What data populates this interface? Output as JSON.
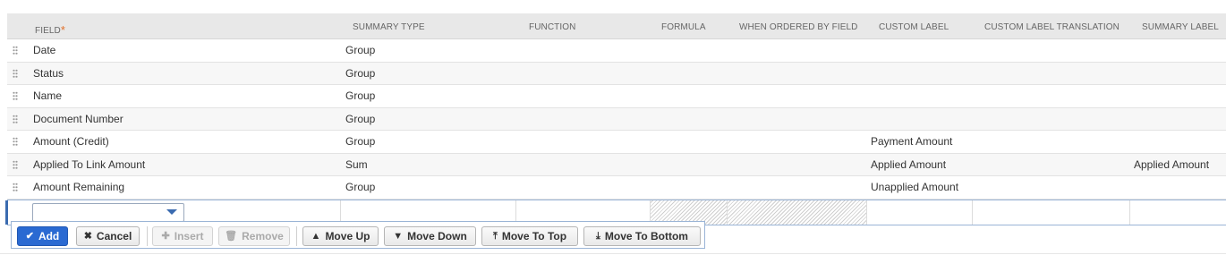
{
  "columns": {
    "field": "FIELD",
    "summary_type": "SUMMARY TYPE",
    "function": "FUNCTION",
    "formula": "FORMULA",
    "when_ordered": "WHEN ORDERED BY FIELD",
    "custom_label": "CUSTOM LABEL",
    "custom_label_translation": "CUSTOM LABEL TRANSLATION",
    "summary_label": "SUMMARY LABEL",
    "required_mark": "*"
  },
  "rows": [
    {
      "field": "Date",
      "summary_type": "Group",
      "custom_label": "",
      "summary_label": ""
    },
    {
      "field": "Status",
      "summary_type": "Group",
      "custom_label": "",
      "summary_label": ""
    },
    {
      "field": "Name",
      "summary_type": "Group",
      "custom_label": "",
      "summary_label": ""
    },
    {
      "field": "Document Number",
      "summary_type": "Group",
      "custom_label": "",
      "summary_label": ""
    },
    {
      "field": "Amount (Credit)",
      "summary_type": "Group",
      "custom_label": "Payment Amount",
      "summary_label": ""
    },
    {
      "field": "Applied To Link Amount",
      "summary_type": "Sum",
      "custom_label": "Applied Amount",
      "summary_label": "Applied Amount"
    },
    {
      "field": "Amount Remaining",
      "summary_type": "Group",
      "custom_label": "Unapplied Amount",
      "summary_label": ""
    }
  ],
  "editor": {
    "field_value": ""
  },
  "toolbar": {
    "add": "Add",
    "cancel": "Cancel",
    "insert": "Insert",
    "remove": "Remove",
    "move_up": "Move Up",
    "move_down": "Move Down",
    "move_to_top": "Move To Top",
    "move_to_bottom": "Move To Bottom"
  },
  "colors": {
    "accent": "#2a6ad2",
    "required": "#e0702a",
    "header_bg": "#e8e8e8"
  }
}
